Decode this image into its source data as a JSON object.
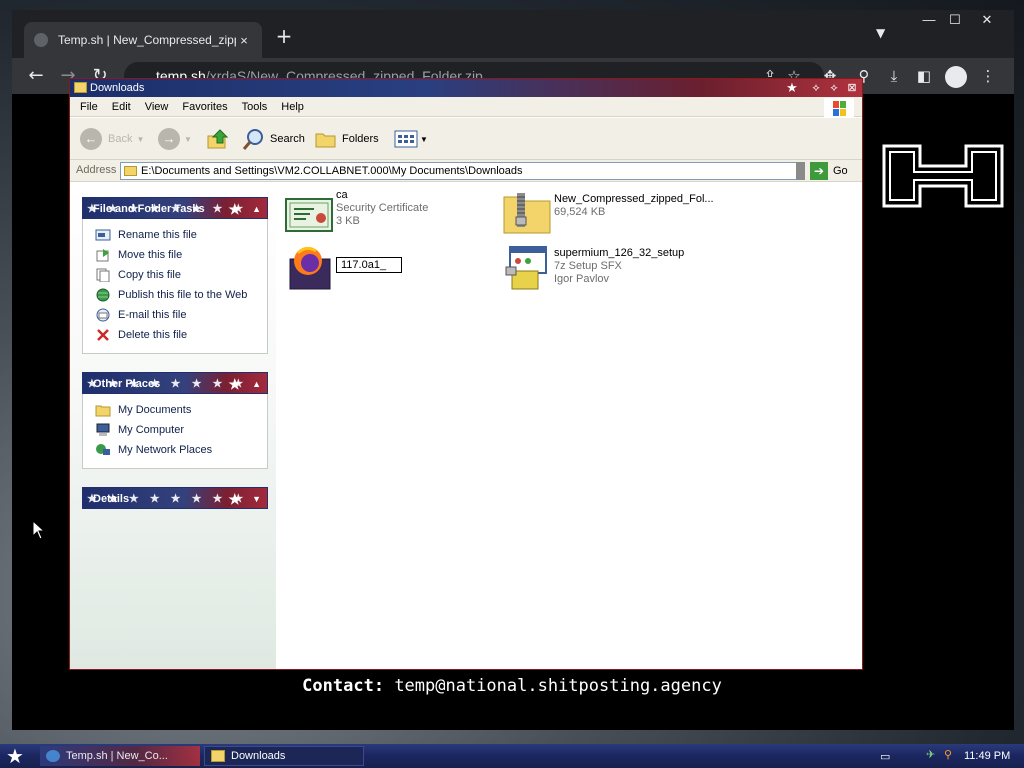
{
  "browser": {
    "tab_title": "Temp.sh | New_Compressed_zipped",
    "tab_close": "×",
    "new_tab": "+",
    "url_host": "temp.sh",
    "url_path": "/xrdaS/New_Compressed_zipped_Folder.zip",
    "window_controls": {
      "minimize": "—",
      "maximize": "☐",
      "close": "✕"
    }
  },
  "page": {
    "contact_label": "Contact:",
    "contact_email": "temp@national.shitposting.agency"
  },
  "explorer": {
    "title": "Downloads",
    "menu": [
      "File",
      "Edit",
      "View",
      "Favorites",
      "Tools",
      "Help"
    ],
    "toolbar": {
      "back_label": "Back",
      "search_label": "Search",
      "folders_label": "Folders"
    },
    "address_label": "Address",
    "address_path": "E:\\Documents and Settings\\VM2.COLLABNET.000\\My Documents\\Downloads",
    "go_label": "Go",
    "tasks": {
      "header": "File and Folder Tasks",
      "items": [
        "Rename this file",
        "Move this file",
        "Copy this file",
        "Publish this file to the Web",
        "E-mail this file",
        "Delete this file"
      ]
    },
    "places": {
      "header": "Other Places",
      "items": [
        "My Documents",
        "My Computer",
        "My Network Places"
      ]
    },
    "details": {
      "header": "Details"
    },
    "files": [
      {
        "name": "ca",
        "type": "Security Certificate",
        "size": "3 KB",
        "icon": "certificate-icon"
      },
      {
        "name": "New_Compressed_zipped_Fol...",
        "type": "69,524 KB",
        "size": "",
        "icon": "zip-folder-icon"
      },
      {
        "name": "117.0a1",
        "rename_value": "117.0a1_",
        "icon": "firefox-installer-icon"
      },
      {
        "name": "supermium_126_32_setup",
        "type": "7z Setup SFX",
        "size": "Igor Pavlov",
        "icon": "installer-icon"
      }
    ]
  },
  "taskbar": {
    "items": [
      "Temp.sh | New_Co...",
      "Downloads"
    ],
    "clock": "11:49 PM"
  },
  "colors": {
    "xp_title_blue": "#1c2f6b",
    "xp_title_red": "#b0323e",
    "chrome_dark": "#202124",
    "pane_link": "#10204a"
  }
}
